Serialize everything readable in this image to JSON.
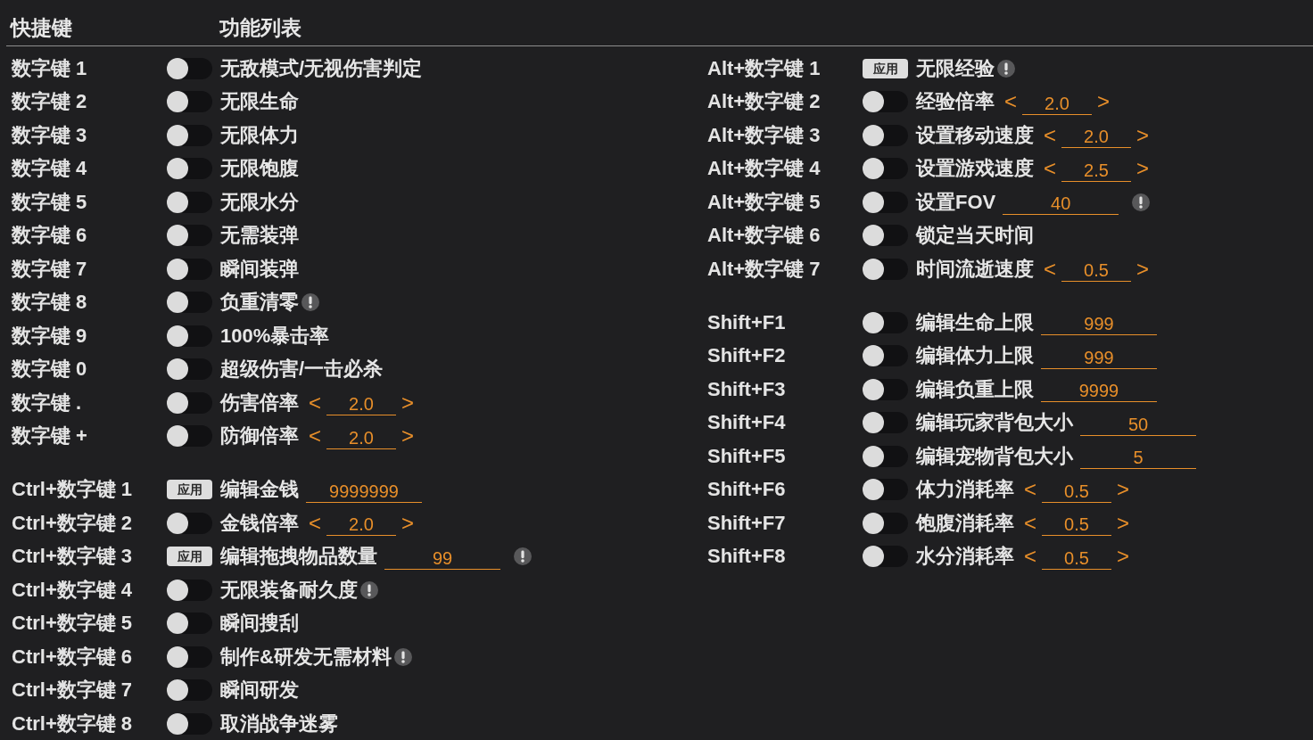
{
  "header": {
    "hotkey_heading": "快捷键",
    "feature_heading": "功能列表"
  },
  "columns": [
    {
      "groups": [
        {
          "rows": [
            {
              "hotkey": "数字键 1",
              "control": {
                "kind": "toggle",
                "on": false
              },
              "label": "无敌模式/无视伤害判定",
              "notice": false
            },
            {
              "hotkey": "数字键 2",
              "control": {
                "kind": "toggle",
                "on": false
              },
              "label": "无限生命",
              "notice": false
            },
            {
              "hotkey": "数字键 3",
              "control": {
                "kind": "toggle",
                "on": false
              },
              "label": "无限体力",
              "notice": false
            },
            {
              "hotkey": "数字键 4",
              "control": {
                "kind": "toggle",
                "on": false
              },
              "label": "无限饱腹",
              "notice": false
            },
            {
              "hotkey": "数字键 5",
              "control": {
                "kind": "toggle",
                "on": false
              },
              "label": "无限水分",
              "notice": false
            },
            {
              "hotkey": "数字键 6",
              "control": {
                "kind": "toggle",
                "on": false
              },
              "label": "无需装弹",
              "notice": false
            },
            {
              "hotkey": "数字键 7",
              "control": {
                "kind": "toggle",
                "on": false
              },
              "label": "瞬间装弹",
              "notice": false
            },
            {
              "hotkey": "数字键 8",
              "control": {
                "kind": "toggle",
                "on": false
              },
              "label": "负重清零",
              "notice": true
            },
            {
              "hotkey": "数字键 9",
              "control": {
                "kind": "toggle",
                "on": false
              },
              "label": "100%暴击率",
              "notice": false
            },
            {
              "hotkey": "数字键 0",
              "control": {
                "kind": "toggle",
                "on": false
              },
              "label": "超级伤害/一击必杀",
              "notice": false
            },
            {
              "hotkey": "数字键 .",
              "control": {
                "kind": "toggle",
                "on": false
              },
              "label": "伤害倍率",
              "input": {
                "kind": "stepper",
                "decrement": "<",
                "value": "2.0",
                "increment": ">"
              },
              "notice": false
            },
            {
              "hotkey": "数字键 +",
              "control": {
                "kind": "toggle",
                "on": false
              },
              "label": "防御倍率",
              "input": {
                "kind": "stepper",
                "decrement": "<",
                "value": "2.0",
                "increment": ">"
              },
              "notice": false
            }
          ]
        },
        {
          "rows": [
            {
              "hotkey": "Ctrl+数字键 1",
              "control": {
                "kind": "button",
                "label": "应用"
              },
              "label": "编辑金钱",
              "input": {
                "kind": "field",
                "value": "9999999"
              },
              "notice": false
            },
            {
              "hotkey": "Ctrl+数字键 2",
              "control": {
                "kind": "toggle",
                "on": false
              },
              "label": "金钱倍率",
              "input": {
                "kind": "stepper",
                "decrement": "<",
                "value": "2.0",
                "increment": ">"
              },
              "notice": false
            },
            {
              "hotkey": "Ctrl+数字键 3",
              "control": {
                "kind": "button",
                "label": "应用"
              },
              "label": "编辑拖拽物品数量",
              "input": {
                "kind": "field",
                "value": "99"
              },
              "notice": true
            },
            {
              "hotkey": "Ctrl+数字键 4",
              "control": {
                "kind": "toggle",
                "on": false
              },
              "label": "无限装备耐久度",
              "notice": true
            },
            {
              "hotkey": "Ctrl+数字键 5",
              "control": {
                "kind": "toggle",
                "on": false
              },
              "label": "瞬间搜刮",
              "notice": false
            },
            {
              "hotkey": "Ctrl+数字键 6",
              "control": {
                "kind": "toggle",
                "on": false
              },
              "label": "制作&研发无需材料",
              "notice": true
            },
            {
              "hotkey": "Ctrl+数字键 7",
              "control": {
                "kind": "toggle",
                "on": false
              },
              "label": "瞬间研发",
              "notice": false
            },
            {
              "hotkey": "Ctrl+数字键 8",
              "control": {
                "kind": "toggle",
                "on": false
              },
              "label": "取消战争迷雾",
              "notice": false
            }
          ]
        }
      ]
    },
    {
      "groups": [
        {
          "rows": [
            {
              "hotkey": "Alt+数字键 1",
              "control": {
                "kind": "button",
                "label": "应用"
              },
              "label": "无限经验",
              "notice": true
            },
            {
              "hotkey": "Alt+数字键 2",
              "control": {
                "kind": "toggle",
                "on": false
              },
              "label": "经验倍率",
              "input": {
                "kind": "stepper",
                "decrement": "<",
                "value": "2.0",
                "increment": ">"
              },
              "notice": false
            },
            {
              "hotkey": "Alt+数字键 3",
              "control": {
                "kind": "toggle",
                "on": false
              },
              "label": "设置移动速度",
              "input": {
                "kind": "stepper",
                "decrement": "<",
                "value": "2.0",
                "increment": ">"
              },
              "notice": false
            },
            {
              "hotkey": "Alt+数字键 4",
              "control": {
                "kind": "toggle",
                "on": false
              },
              "label": "设置游戏速度",
              "input": {
                "kind": "stepper",
                "decrement": "<",
                "value": "2.5",
                "increment": ">"
              },
              "notice": false
            },
            {
              "hotkey": "Alt+数字键 5",
              "control": {
                "kind": "toggle",
                "on": false
              },
              "label": "设置FOV",
              "input": {
                "kind": "field",
                "value": "40"
              },
              "notice": true
            },
            {
              "hotkey": "Alt+数字键 6",
              "control": {
                "kind": "toggle",
                "on": false
              },
              "label": "锁定当天时间",
              "notice": false
            },
            {
              "hotkey": "Alt+数字键 7",
              "control": {
                "kind": "toggle",
                "on": false
              },
              "label": "时间流逝速度",
              "input": {
                "kind": "stepper",
                "decrement": "<",
                "value": "0.5",
                "increment": ">"
              },
              "notice": false
            }
          ]
        },
        {
          "rows": [
            {
              "hotkey": "Shift+F1",
              "control": {
                "kind": "toggle",
                "on": false
              },
              "label": "编辑生命上限",
              "input": {
                "kind": "field",
                "value": "999"
              },
              "notice": false
            },
            {
              "hotkey": "Shift+F2",
              "control": {
                "kind": "toggle",
                "on": false
              },
              "label": "编辑体力上限",
              "input": {
                "kind": "field",
                "value": "999"
              },
              "notice": false
            },
            {
              "hotkey": "Shift+F3",
              "control": {
                "kind": "toggle",
                "on": false
              },
              "label": "编辑负重上限",
              "input": {
                "kind": "field",
                "value": "9999"
              },
              "notice": false
            },
            {
              "hotkey": "Shift+F4",
              "control": {
                "kind": "toggle",
                "on": false
              },
              "label": "编辑玩家背包大小",
              "input": {
                "kind": "field",
                "value": "50"
              },
              "notice": false
            },
            {
              "hotkey": "Shift+F5",
              "control": {
                "kind": "toggle",
                "on": false
              },
              "label": "编辑宠物背包大小",
              "input": {
                "kind": "field",
                "value": "5"
              },
              "notice": false
            },
            {
              "hotkey": "Shift+F6",
              "control": {
                "kind": "toggle",
                "on": false
              },
              "label": "体力消耗率",
              "input": {
                "kind": "stepper",
                "decrement": "<",
                "value": "0.5",
                "increment": ">"
              },
              "notice": false
            },
            {
              "hotkey": "Shift+F7",
              "control": {
                "kind": "toggle",
                "on": false
              },
              "label": "饱腹消耗率",
              "input": {
                "kind": "stepper",
                "decrement": "<",
                "value": "0.5",
                "increment": ">"
              },
              "notice": false
            },
            {
              "hotkey": "Shift+F8",
              "control": {
                "kind": "toggle",
                "on": false
              },
              "label": "水分消耗率",
              "input": {
                "kind": "stepper",
                "decrement": "<",
                "value": "0.5",
                "increment": ">"
              },
              "notice": false
            }
          ]
        }
      ]
    }
  ]
}
